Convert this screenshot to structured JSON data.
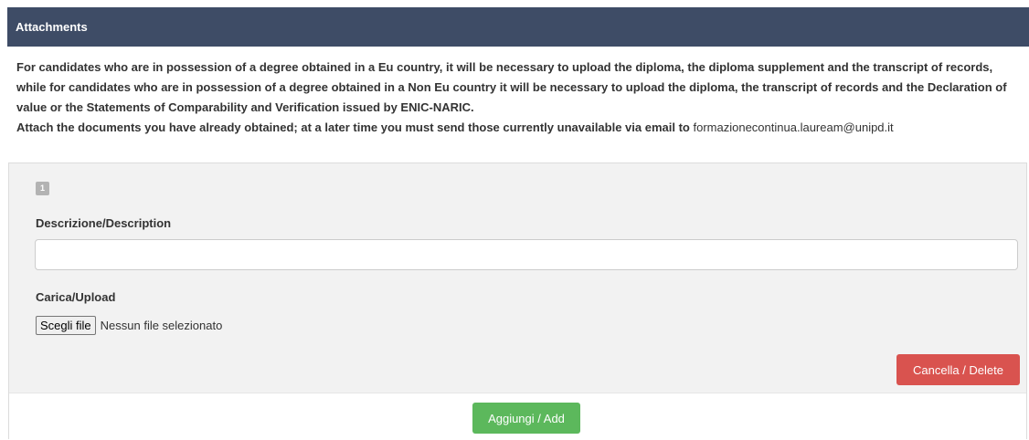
{
  "panel": {
    "title": "Attachments"
  },
  "intro": {
    "paragraph": "For candidates who are in possession of a degree obtained in a Eu country, it will be necessary to upload the diploma, the diploma supplement and the transcript of records, while for candidates who are in possession of a degree obtained in a Non Eu country it will be necessary to upload the diploma, the transcript of records and the Declaration of value or the Statements of Comparability and Verification issued by ENIC-NARIC.",
    "attach_note": "Attach the documents you have already obtained; at a later time you must send those currently unavailable via email to",
    "email": "formazionecontinua.lauream@unipd.it"
  },
  "attachment_item": {
    "index": "1",
    "description_label": "Descrizione/Description",
    "description_value": "",
    "upload_label": "Carica/Upload",
    "file_button_label": "Scegli file",
    "file_status": "Nessun file selezionato",
    "delete_label": "Cancella / Delete"
  },
  "actions": {
    "add_label": "Aggiungi / Add"
  },
  "colors": {
    "header_bg": "#3e4c66",
    "delete_bg": "#d9534f",
    "add_bg": "#5cb85c",
    "item_bg": "#f2f2f2"
  }
}
